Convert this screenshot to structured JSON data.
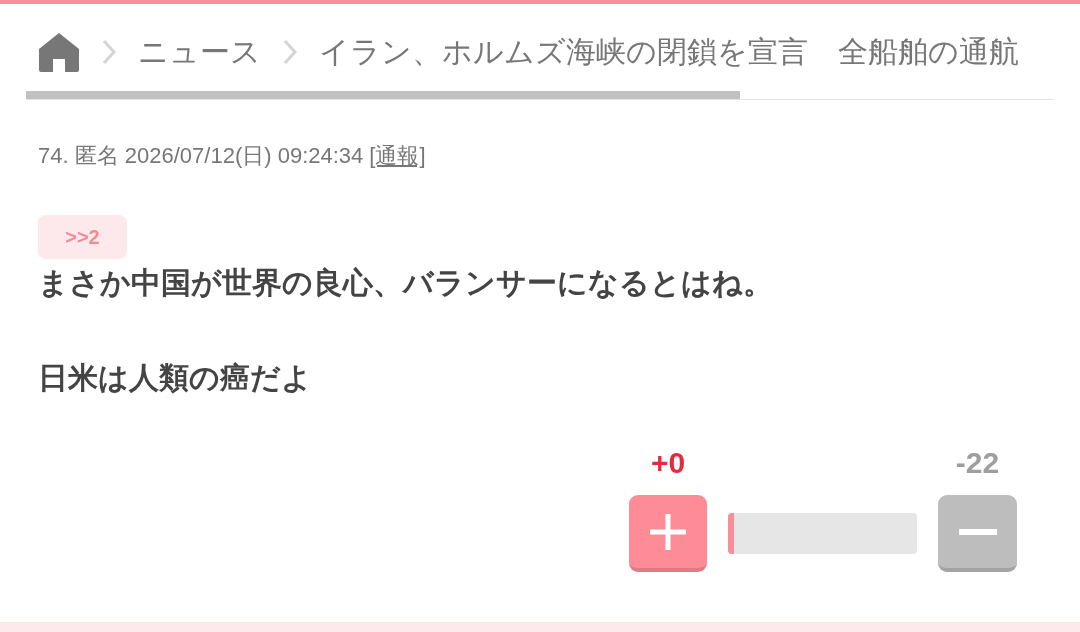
{
  "breadcrumb": {
    "items": [
      "ニュース",
      "イラン、ホルムズ海峡の閉鎖を宣言　全船舶の通航"
    ]
  },
  "post": {
    "header": "74. 匿名 2026/07/12(日) 09:24:34",
    "report_link": "[通報]",
    "reply_anchor": ">>2",
    "body": [
      "まさか中国が世界の良心、バランサーになるとはね。",
      "日米は人類の癌だよ"
    ],
    "votes": {
      "plus": "+0",
      "minus": "-22",
      "level": 0.03
    }
  }
}
